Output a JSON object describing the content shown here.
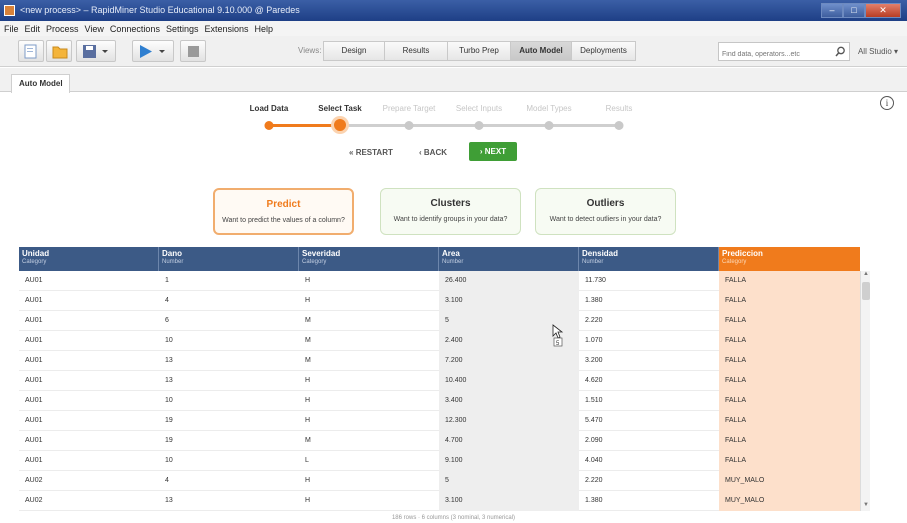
{
  "window": {
    "title": "<new process> – RapidMiner Studio Educational 9.10.000 @ Paredes",
    "min": "–",
    "max": "□",
    "close": "✕"
  },
  "menu": [
    "File",
    "Edit",
    "Process",
    "View",
    "Connections",
    "Settings",
    "Extensions",
    "Help"
  ],
  "toolbar": {
    "views_label": "Views:",
    "views": [
      "Design",
      "Results",
      "Turbo Prep",
      "Auto Model",
      "Deployments"
    ],
    "active_view": "Auto Model",
    "search_placeholder": "Find data, operators...etc",
    "studio_select": "All Studio ▾"
  },
  "panel_tab": "Auto Model",
  "wizard": {
    "steps": [
      {
        "label": "Load Data",
        "state": "done"
      },
      {
        "label": "Select Task",
        "state": "current"
      },
      {
        "label": "Prepare Target",
        "state": "todo"
      },
      {
        "label": "Select Inputs",
        "state": "todo"
      },
      {
        "label": "Model Types",
        "state": "todo"
      },
      {
        "label": "Results",
        "state": "todo"
      }
    ],
    "restart_label": "RESTART",
    "back_label": "BACK",
    "next_label": "NEXT"
  },
  "tasks": [
    {
      "title": "Predict",
      "desc": "Want to predict the values of a column?",
      "selected": true
    },
    {
      "title": "Clusters",
      "desc": "Want to identify groups in your data?",
      "selected": false
    },
    {
      "title": "Outliers",
      "desc": "Want to detect outliers in your data?",
      "selected": false
    }
  ],
  "table": {
    "columns": [
      {
        "name": "Unidad",
        "type": "Category"
      },
      {
        "name": "Dano",
        "type": "Number"
      },
      {
        "name": "Severidad",
        "type": "Category"
      },
      {
        "name": "Area",
        "type": "Number"
      },
      {
        "name": "Densidad",
        "type": "Number"
      },
      {
        "name": "Prediccion",
        "type": "Category"
      }
    ],
    "rows": [
      [
        "AU01",
        "1",
        "H",
        "26.400",
        "11.730",
        "FALLA"
      ],
      [
        "AU01",
        "4",
        "H",
        "3.100",
        "1.380",
        "FALLA"
      ],
      [
        "AU01",
        "6",
        "M",
        "5",
        "2.220",
        "FALLA"
      ],
      [
        "AU01",
        "10",
        "M",
        "2.400",
        "1.070",
        "FALLA"
      ],
      [
        "AU01",
        "13",
        "M",
        "7.200",
        "3.200",
        "FALLA"
      ],
      [
        "AU01",
        "13",
        "H",
        "10.400",
        "4.620",
        "FALLA"
      ],
      [
        "AU01",
        "10",
        "H",
        "3.400",
        "1.510",
        "FALLA"
      ],
      [
        "AU01",
        "19",
        "H",
        "12.300",
        "5.470",
        "FALLA"
      ],
      [
        "AU01",
        "19",
        "M",
        "4.700",
        "2.090",
        "FALLA"
      ],
      [
        "AU01",
        "10",
        "L",
        "9.100",
        "4.040",
        "FALLA"
      ],
      [
        "AU02",
        "4",
        "H",
        "5",
        "2.220",
        "MUY_MALO"
      ],
      [
        "AU02",
        "13",
        "H",
        "3.100",
        "1.380",
        "MUY_MALO"
      ]
    ],
    "status": "186 rows · 6 columns (3 nominal, 3 numerical)"
  },
  "info_symbol": "i",
  "cursor_tooltip": "5",
  "colors": {
    "accent_orange": "#f07b1c",
    "header_blue": "#3c5a86",
    "next_green": "#3f9e36",
    "prediction_bg": "#fde0cb"
  }
}
